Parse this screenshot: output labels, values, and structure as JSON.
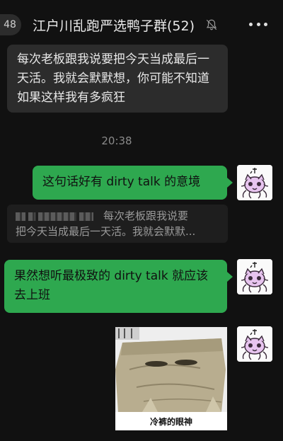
{
  "header": {
    "back_badge": "48",
    "title": "江户川乱跑严选鸭子群(52)",
    "icons": [
      "mute-bell-icon",
      "more-dots-icon"
    ]
  },
  "messages": {
    "m1": "每次老板跟我说要把今天当成最后一天活。我就会默默想，你可能不知道如果这样我有多疯狂",
    "time": "20:38",
    "m2": "这句话好有 dirty talk 的意境",
    "quote_line1": "每次老板跟我说要",
    "quote_line2": "把今天当成最后一天活。我就会默默...",
    "m3": "果然想听最极致的 dirty talk 就应该去上班",
    "image_caption": "冷裤的眼神"
  },
  "colors": {
    "background": "#111111",
    "incoming_bubble": "#2c2c2c",
    "outgoing_bubble": "#2ea84f"
  }
}
